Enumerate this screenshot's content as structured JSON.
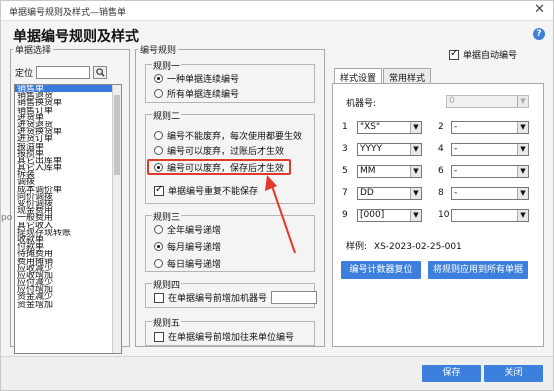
{
  "window": {
    "title": "单据编号规则及样式—销售单",
    "heading": "单据编号规则及样式"
  },
  "auto_number": {
    "label": "单据自动编号",
    "checked": true
  },
  "left": {
    "legend": "单据选择",
    "locate_label": "定位",
    "items": [
      "销售单",
      "销售退货",
      "销售换货单",
      "销售订单",
      "进货单",
      "进货退货",
      "进货换货单",
      "进货订单",
      "报溢单",
      "报损单",
      "其它出库单",
      "其它入库单",
      "拆装",
      "调拨",
      "成本调价单",
      "同价调拨",
      "变价调拨",
      "现金费用",
      "一般费用",
      "其它收入",
      "提现存现转账",
      "收款单",
      "付款单",
      "待摊费用",
      "费用摊销",
      "应收减少",
      "应收增加",
      "应付减少",
      "应付增加",
      "资金减少",
      "资金增加"
    ],
    "selected_index": 0
  },
  "rules": {
    "legend": "编号规则",
    "rule1": {
      "title": "规则一",
      "options": [
        "一种单据连续编号",
        "所有单据连续编号"
      ]
    },
    "rule2": {
      "title": "规则二",
      "options": [
        "编号不能废弃，每次使用都要生效",
        "编号可以废弃，过账后才生效",
        "编号可以废弃，保存后才生效"
      ],
      "duplicate_label": "单据编号重复不能保存"
    },
    "rule3": {
      "title": "规则三",
      "options": [
        "全年编号递增",
        "每月编号递增",
        "每日编号递增"
      ]
    },
    "rule4": {
      "title": "规则四",
      "label": "在单据编号前增加机器号"
    },
    "rule5": {
      "title": "规则五",
      "label": "在单据编号前增加往来单位编号"
    }
  },
  "tabs": [
    "样式设置",
    "常用样式"
  ],
  "style": {
    "machine_label": "机器号:",
    "machine_value": "0",
    "fields": [
      {
        "n": "1",
        "v": "\"XS\""
      },
      {
        "n": "2",
        "v": "-"
      },
      {
        "n": "3",
        "v": "YYYY"
      },
      {
        "n": "4",
        "v": "-"
      },
      {
        "n": "5",
        "v": "MM"
      },
      {
        "n": "6",
        "v": "-"
      },
      {
        "n": "7",
        "v": "DD"
      },
      {
        "n": "8",
        "v": "-"
      },
      {
        "n": "9",
        "v": "[000]"
      },
      {
        "n": "10",
        "v": ""
      }
    ],
    "sample_label": "样例:",
    "sample_value": "XS-2023-02-25-001",
    "reset_button": "编号计数器复位",
    "apply_button": "将规则应用到所有单据"
  },
  "footer": {
    "save": "保存",
    "close": "关闭"
  },
  "colors": {
    "accent": "#3d7fdd",
    "highlight": "#e03a2c",
    "selection": "#3b78e0"
  }
}
